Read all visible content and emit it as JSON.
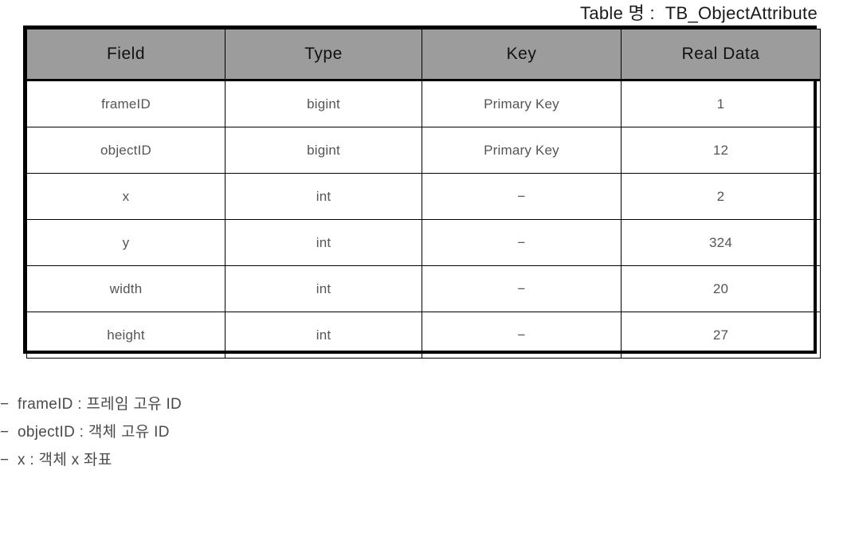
{
  "title": {
    "text": "Table 명 :  TB_ObjectAttribute"
  },
  "table": {
    "columns": [
      {
        "key": "field",
        "label": "Field"
      },
      {
        "key": "type",
        "label": "Type"
      },
      {
        "key": "key",
        "label": "Key"
      },
      {
        "key": "real_data",
        "label": "Real  Data"
      }
    ],
    "rows": [
      {
        "field": "frameID",
        "type": "bigint",
        "key": "Primary  Key",
        "real_data": "1"
      },
      {
        "field": "objectID",
        "type": "bigint",
        "key": "Primary  Key",
        "real_data": "12"
      },
      {
        "field": "x",
        "type": "int",
        "key": "−",
        "real_data": "2"
      },
      {
        "field": "y",
        "type": "int",
        "key": "−",
        "real_data": "324"
      },
      {
        "field": "width",
        "type": "int",
        "key": "−",
        "real_data": "20"
      },
      {
        "field": "height",
        "type": "int",
        "key": "−",
        "real_data": "27"
      }
    ]
  },
  "notes": {
    "bullet": "−",
    "items": [
      {
        "text": "frameID : 프레임 고유 ID"
      },
      {
        "text": "objectID : 객체 고유 ID"
      },
      {
        "text": "x : 객체 x 좌표"
      }
    ]
  },
  "colors": {
    "header_background": "#9c9c9c",
    "border": "#000000",
    "cell_text": "#555555",
    "title_text": "#1a1a1a",
    "note_text": "#4a4a4a",
    "page_background": "#ffffff"
  }
}
